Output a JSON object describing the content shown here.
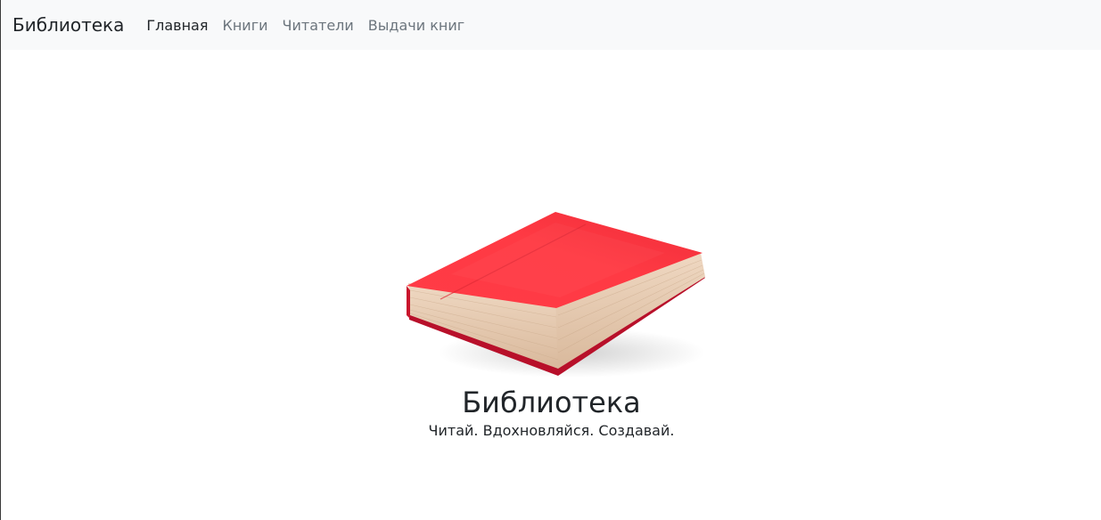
{
  "navbar": {
    "brand": "Библиотека",
    "links": [
      {
        "label": "Главная",
        "active": true
      },
      {
        "label": "Книги",
        "active": false
      },
      {
        "label": "Читатели",
        "active": false
      },
      {
        "label": "Выдачи книг",
        "active": false
      }
    ]
  },
  "hero": {
    "image_icon": "red-book-image",
    "title": "Библиотека",
    "subtitle": "Читай. Вдохновляйся. Создавай."
  },
  "colors": {
    "navbar_bg": "#f8f9fa",
    "book_red": "#f5333f",
    "pages": "#e7cdb5",
    "text_dark": "#212529",
    "text_muted": "#6c757d"
  }
}
